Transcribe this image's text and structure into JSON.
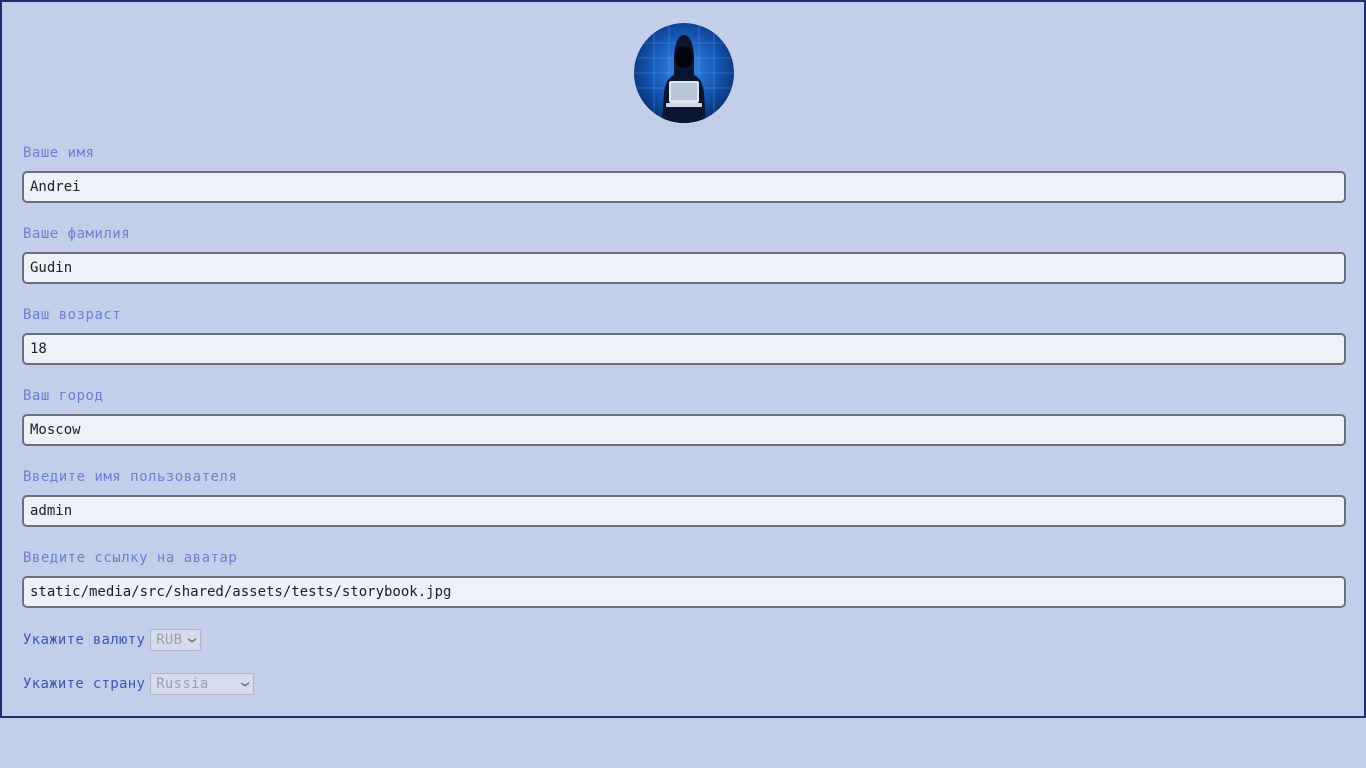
{
  "profile": {
    "avatar_icon": "hooded-hacker-avatar",
    "fields": [
      {
        "label": "Ваше имя",
        "value": "Andrei"
      },
      {
        "label": "Ваше фамилия",
        "value": "Gudin"
      },
      {
        "label": "Ваш возраст",
        "value": "18"
      },
      {
        "label": "Ваш город",
        "value": "Moscow"
      },
      {
        "label": "Введите имя пользователя",
        "value": "admin"
      },
      {
        "label": "Введите ссылку на аватар",
        "value": "static/media/src/shared/assets/tests/storybook.jpg"
      }
    ],
    "currency": {
      "label": "Укажите валюту",
      "selected": "RUB"
    },
    "country": {
      "label": "Укажите страну",
      "selected": "Russia"
    }
  },
  "colors": {
    "background": "#c3cfea",
    "border": "#1c2e78",
    "label": "#6b7fd3",
    "input_bg": "#ecf1fa"
  }
}
